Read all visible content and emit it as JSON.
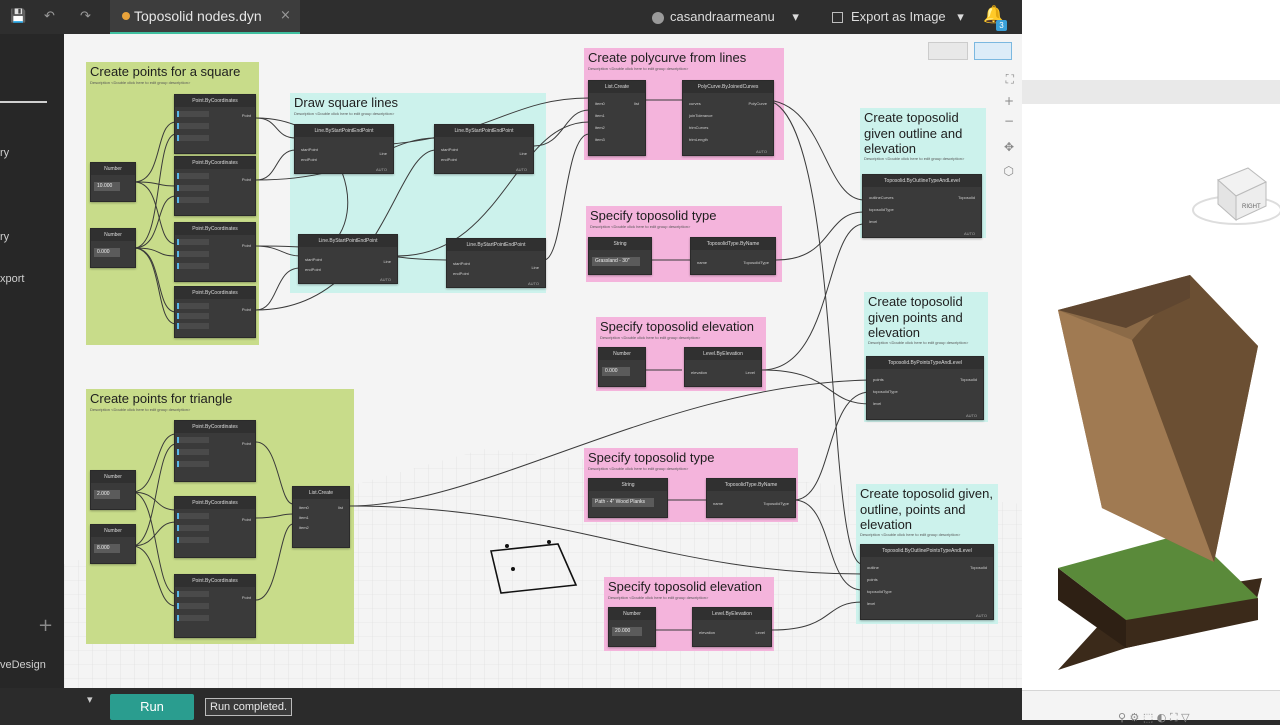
{
  "tab": {
    "title": "Toposolid nodes.dyn",
    "close": "×"
  },
  "toolbar": {
    "save": "💾",
    "undo": "↶",
    "redo": "↷"
  },
  "user": {
    "name": "casandraarmeanu",
    "icon": "person-icon",
    "chevron": "▾"
  },
  "export": {
    "label": "Export as Image",
    "chevron": "▾"
  },
  "notifications": {
    "count": "3",
    "icon": "bell-icon"
  },
  "sidebar": {
    "items": [
      "ry",
      "ry",
      "xport",
      "veDesign"
    ],
    "plus": "+"
  },
  "groups": {
    "square_points": {
      "title": "Create points for a square",
      "desc": "Description <Double click here to edit group description>"
    },
    "square_lines": {
      "title": "Draw square lines",
      "desc": "Description <Double click here to edit group description>"
    },
    "polycurve": {
      "title": "Create polycurve from lines",
      "desc": "Description <Double click here to edit group description>"
    },
    "type1": {
      "title": "Specify toposolid type",
      "desc": "Description <Double click here to edit group description>"
    },
    "elev1": {
      "title": "Specify toposolid elevation",
      "desc": "Description <Double click here to edit group description>"
    },
    "topo_outline": {
      "title": "Create toposolid given outline and elevation",
      "desc": "Description <Double click here to edit group description>"
    },
    "topo_points": {
      "title": "Create toposolid given points and elevation",
      "desc": "Description <Double click here to edit group description>"
    },
    "triangle_points": {
      "title": "Create points for triangle",
      "desc": "Description <Double click here to edit group description>"
    },
    "type2": {
      "title": "Specify toposolid type",
      "desc": "Description <Double click here to edit group description>"
    },
    "elev2": {
      "title": "Specify toposolid elevation",
      "desc": "Description <Double click here to edit group description>"
    },
    "topo_all": {
      "title": "Create toposolid given, outline, points and elevation",
      "desc": "Description <Double click here to edit group description>"
    }
  },
  "nodes": {
    "point": "Point.ByCoordinates",
    "line": "Line.ByStartPointEndPoint",
    "list_create": "List.Create",
    "polycurve": "PolyCurve.ByJoinedCurves",
    "number": "Number",
    "string": "String",
    "type_by_name": "ToposolidType.ByName",
    "level": "Level.ByElevation",
    "topo_outline": "Toposolid.ByOutlineTypeAndLevel",
    "topo_points": "Toposolid.ByPointsTypeAndLevel",
    "topo_all": "Toposolid.ByOutlinePointsTypeAndLevel",
    "auto": "AUTO"
  },
  "values": {
    "num_square_1": "10.000",
    "num_square_2": "0.000",
    "num_tri_1": "2.000",
    "num_tri_2": "8.000",
    "num_elev_1": "0.000",
    "num_elev_2": "20.000",
    "string_1": "Grassland - 30\"",
    "string_2": "Path - 4\" Wood Planks"
  },
  "ports": {
    "x": "x",
    "y": "y",
    "z": "z",
    "point": "Point",
    "start": "startPoint",
    "end": "endPoint",
    "line": "Line",
    "item0": "item0",
    "item1": "item1",
    "item2": "item2",
    "item3": "item3",
    "list": "list",
    "curves": "curves",
    "tol": "joinTolerance",
    "trim": "trimCurves",
    "trimlen": "trimLength",
    "polycurve": "PolyCurve",
    "name": "name",
    "ttype": "ToposolidType",
    "elevation": "elevation",
    "level": "Level",
    "outline": "outlineCurves",
    "toposolidType": "toposolidType",
    "levelin": "level",
    "toposolid": "Toposolid",
    "points": "points",
    "outline2": "outline"
  },
  "bottom": {
    "run": "Run",
    "status": "Run completed.",
    "chevron": "▾"
  },
  "colors": {
    "green": "#c8dc8a",
    "cyan": "#ccf2ec",
    "pink": "#f4b4dc",
    "run": "#2a9d8f"
  }
}
